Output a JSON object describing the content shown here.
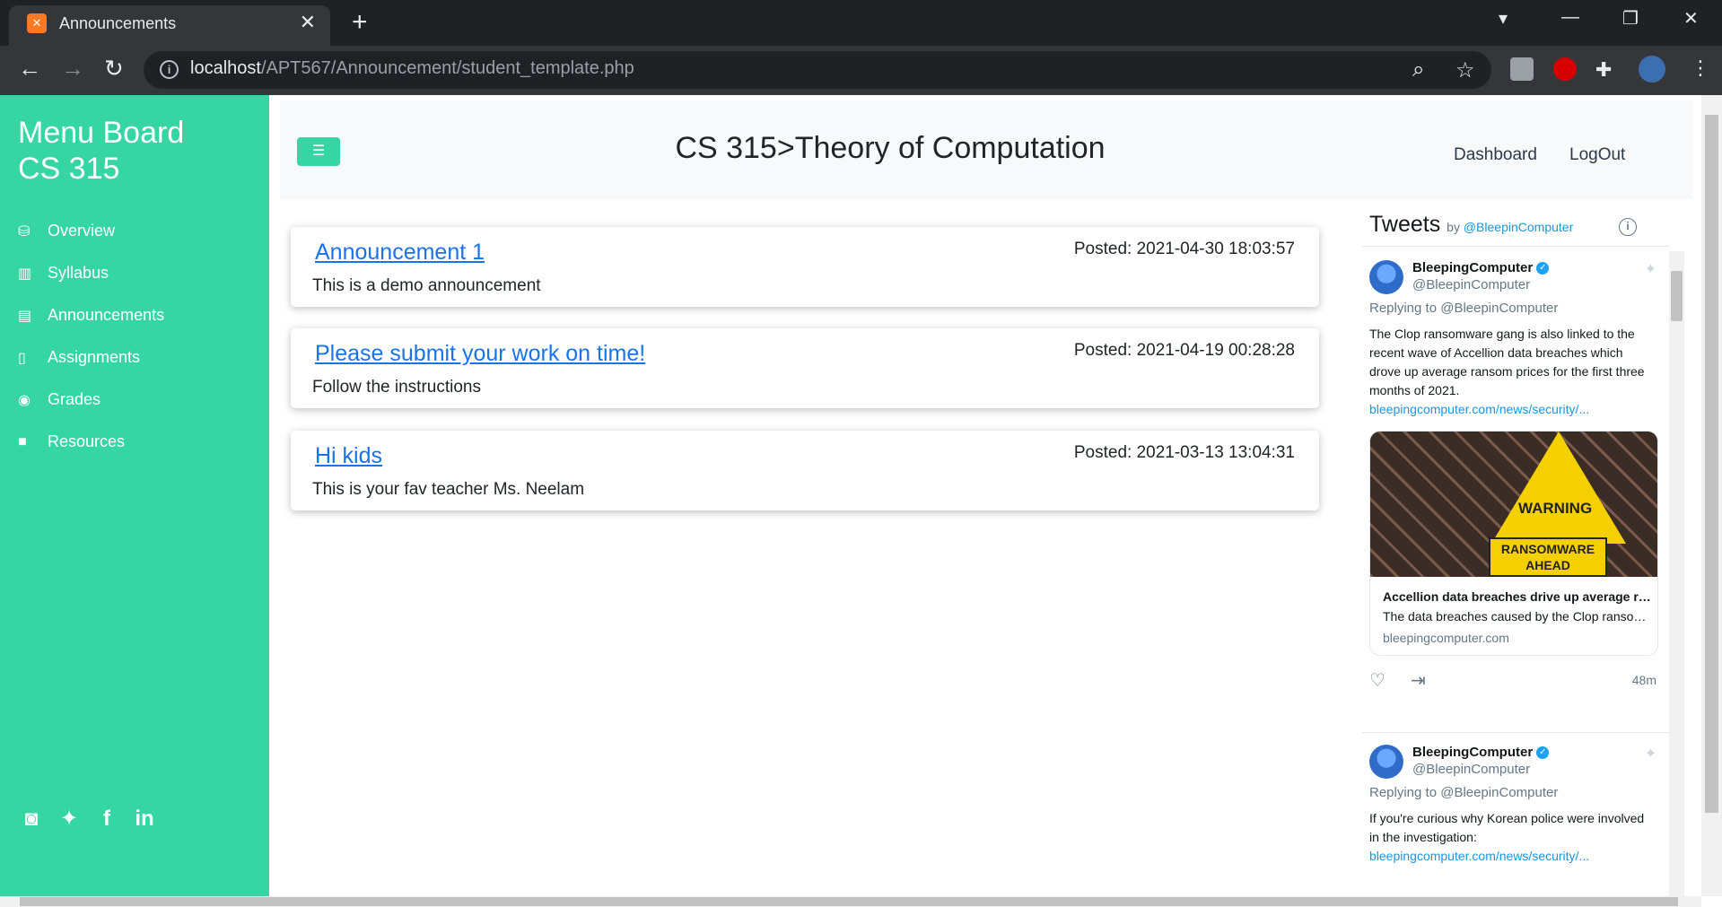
{
  "browser": {
    "tab_title": "Announcements",
    "tab_icon": "xampp-icon",
    "url_host": "localhost",
    "url_path": "/APT567/Announcement/student_template.php"
  },
  "sidebar": {
    "brand_line1": "Menu Board",
    "brand_line2": "CS 315",
    "items": [
      {
        "label": "Overview",
        "icon": "overview-icon"
      },
      {
        "label": "Syllabus",
        "icon": "book-icon"
      },
      {
        "label": "Announcements",
        "icon": "chat-icon"
      },
      {
        "label": "Assignments",
        "icon": "document-icon"
      },
      {
        "label": "Grades",
        "icon": "medal-icon"
      },
      {
        "label": "Resources",
        "icon": "resources-icon"
      }
    ],
    "social": [
      "instagram-icon",
      "twitter-icon",
      "facebook-icon",
      "linkedin-icon"
    ],
    "accent": "#35d6a1"
  },
  "header": {
    "title": "CS 315>Theory of Computation",
    "links": [
      "Dashboard",
      "LogOut"
    ]
  },
  "announcements": [
    {
      "title": "Announcement 1",
      "posted": "Posted: 2021-04-30 18:03:57",
      "body": "This is a demo announcement"
    },
    {
      "title": "Please submit your work on time!",
      "posted": "Posted: 2021-04-19 00:28:28",
      "body": "Follow the instructions"
    },
    {
      "title": "Hi kids",
      "posted": "Posted: 2021-03-13 13:04:31",
      "body": "This is your fav teacher Ms. Neelam"
    }
  ],
  "twitter": {
    "heading": "Tweets",
    "by": "by",
    "by_handle": "@BleepinComputer",
    "tweets": [
      {
        "name": "BleepingComputer",
        "handle": "@BleepinComputer",
        "reply": "Replying to @BleepinComputer",
        "text": "The Clop ransomware gang is also linked to the recent wave of Accellion data breaches which drove up average ransom prices for the first three months of 2021.",
        "link": "bleepingcomputer.com/news/security/...",
        "card_title": "Accellion data breaches drive up average ransom price",
        "card_desc": "The data breaches caused by the Clop ransomware gang",
        "card_domain": "bleepingcomputer.com",
        "card_sign_top": "WARNING",
        "card_sign_bottom": "RANSOMWARE AHEAD",
        "time": "48m"
      },
      {
        "name": "BleepingComputer",
        "handle": "@BleepinComputer",
        "reply": "Replying to @BleepinComputer",
        "text": "If you're curious why Korean police were involved in the investigation:",
        "link": "bleepingcomputer.com/news/security/..."
      }
    ]
  }
}
